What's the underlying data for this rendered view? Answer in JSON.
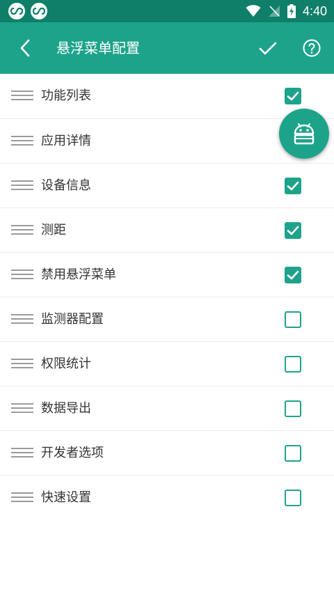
{
  "status_bar": {
    "time": "4:40"
  },
  "app_bar": {
    "title": "悬浮菜单配置"
  },
  "items": [
    {
      "label": "功能列表",
      "checked": true
    },
    {
      "label": "应用详情",
      "checked": true
    },
    {
      "label": "设备信息",
      "checked": true
    },
    {
      "label": "测距",
      "checked": true
    },
    {
      "label": "禁用悬浮菜单",
      "checked": true
    },
    {
      "label": "监测器配置",
      "checked": false
    },
    {
      "label": "权限统计",
      "checked": false
    },
    {
      "label": "数据导出",
      "checked": false
    },
    {
      "label": "开发者选项",
      "checked": false
    },
    {
      "label": "快速设置",
      "checked": false
    }
  ],
  "colors": {
    "accent": "#1ea38b",
    "status_bar": "#0f7f69"
  }
}
